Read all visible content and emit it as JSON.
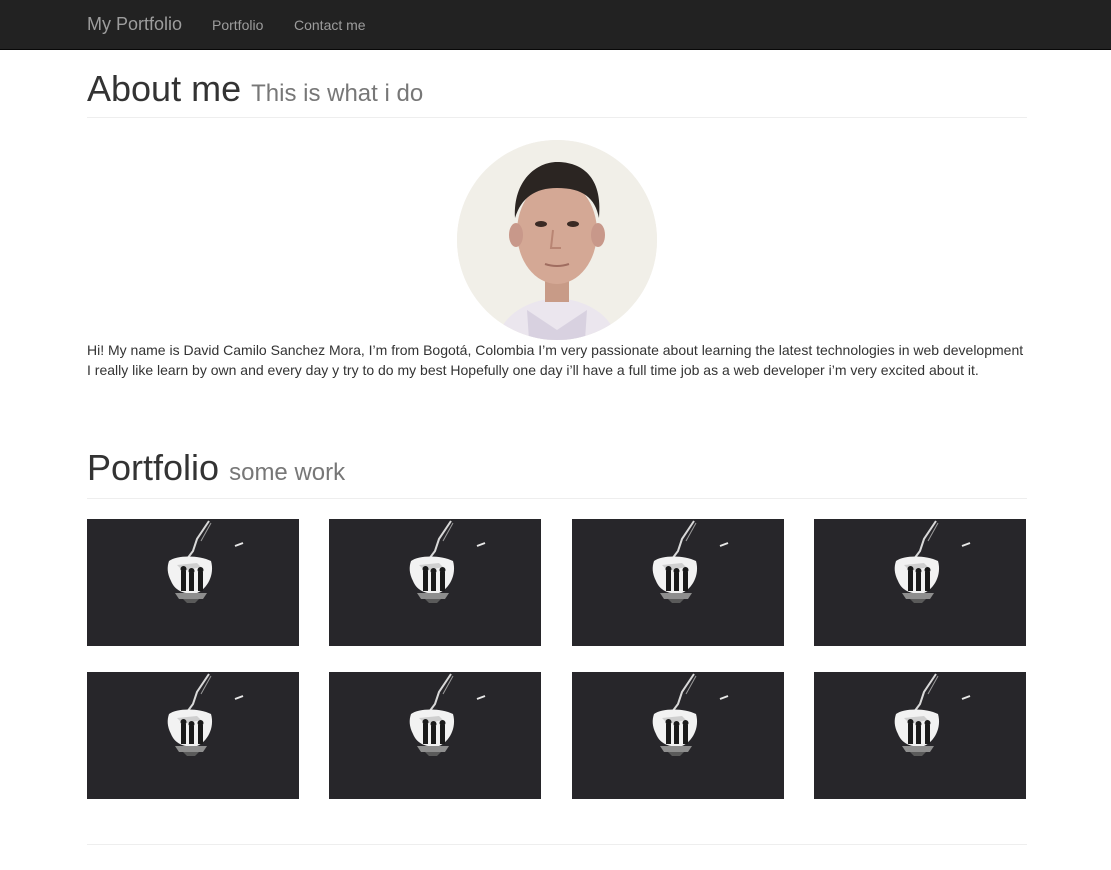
{
  "navbar": {
    "brand": "My Portfolio",
    "links": [
      {
        "label": "Portfolio"
      },
      {
        "label": "Contact me"
      }
    ]
  },
  "about": {
    "title": "About me",
    "subtitle": "This is what i do",
    "bio": "Hi! My name is David Camilo Sanchez Mora, I’m from Bogotá, Colombia I’m very passionate about learning the latest technologies in web development I really like learn by own and every day y try to do my best Hopefully one day i’ll have a full time job as a web developer i’m very excited about it."
  },
  "portfolio": {
    "title": "Portfolio",
    "subtitle": "some work",
    "items": [
      {
        "thumbnail": "portfolio-thumbnail"
      },
      {
        "thumbnail": "portfolio-thumbnail"
      },
      {
        "thumbnail": "portfolio-thumbnail"
      },
      {
        "thumbnail": "portfolio-thumbnail"
      },
      {
        "thumbnail": "portfolio-thumbnail"
      },
      {
        "thumbnail": "portfolio-thumbnail"
      },
      {
        "thumbnail": "portfolio-thumbnail"
      },
      {
        "thumbnail": "portfolio-thumbnail"
      }
    ]
  },
  "colors": {
    "navbar_bg": "#222222",
    "nav_text": "#9d9d9d",
    "thumb_bg": "#27262a",
    "subtitle": "#777777"
  }
}
